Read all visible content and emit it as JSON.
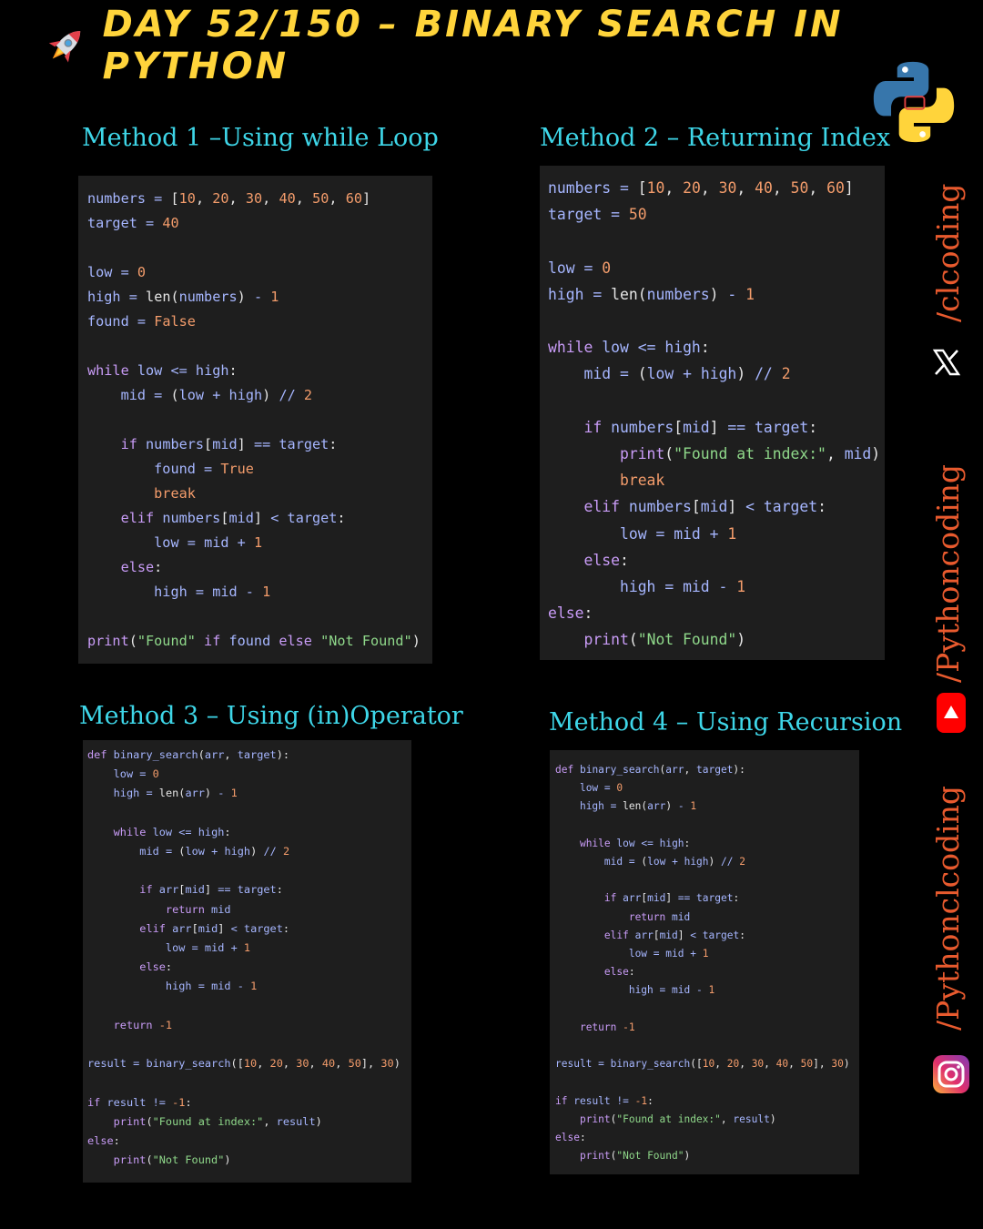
{
  "header": {
    "title": "DAY 52/150 – BINARY SEARCH IN PYTHON"
  },
  "methods": [
    {
      "heading": "Method 1 –Using while Loop"
    },
    {
      "heading": "Method 2 – Returning Index"
    },
    {
      "heading": "Method 3 – Using (in)Operator"
    },
    {
      "heading": "Method 4 –  Using  Recursion"
    }
  ],
  "social": {
    "x_handle": "/clcoding",
    "youtube_handle": "/Pythoncoding",
    "instagram_handle": "/Pythonclcoding"
  },
  "icons": [
    "rocket-icon",
    "python-logo-icon",
    "x-icon",
    "youtube-icon",
    "instagram-icon"
  ],
  "colors": {
    "title": "#ffd43b",
    "heading": "#3ed6e8",
    "handle": "#e85a2e",
    "code_bg": "#1e1e1e"
  }
}
